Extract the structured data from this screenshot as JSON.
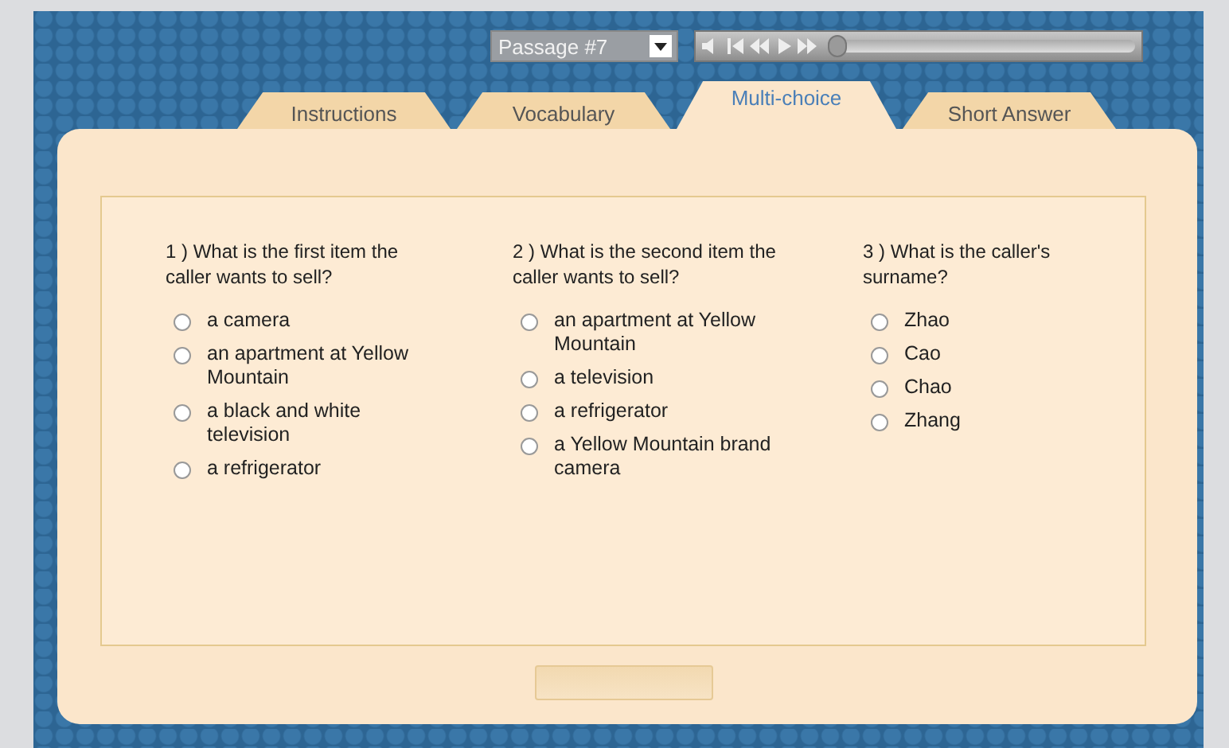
{
  "player": {
    "passage": {
      "value": "Passage #7"
    },
    "progress": {
      "level": 0.0
    }
  },
  "tabs": [
    {
      "label": "Instructions",
      "selected": false
    },
    {
      "label": "Vocabulary",
      "selected": false
    },
    {
      "label": "Multi-choice",
      "selected": true
    },
    {
      "label": "Short Answer",
      "selected": false
    }
  ],
  "questions": [
    {
      "prompt": "1 ) What is the first item the caller wants to sell?",
      "options": [
        {
          "label": "a camera",
          "selected": false
        },
        {
          "label": "an apartment at Yellow Mountain",
          "selected": false
        },
        {
          "label": "a black and white television",
          "selected": false
        },
        {
          "label": "a refrigerator",
          "selected": false
        }
      ]
    },
    {
      "prompt": "2 ) What is the second item the caller wants to sell?",
      "options": [
        {
          "label": "an apartment at Yellow Mountain",
          "selected": false
        },
        {
          "label": "a television",
          "selected": false
        },
        {
          "label": "a refrigerator",
          "selected": false
        },
        {
          "label": "a Yellow Mountain brand camera",
          "selected": false
        }
      ]
    },
    {
      "prompt": "3 ) What is the caller's surname?",
      "options": [
        {
          "label": "Zhao",
          "selected": false
        },
        {
          "label": "Cao",
          "selected": false
        },
        {
          "label": "Chao",
          "selected": false
        },
        {
          "label": "Zhang",
          "selected": false
        }
      ]
    }
  ]
}
